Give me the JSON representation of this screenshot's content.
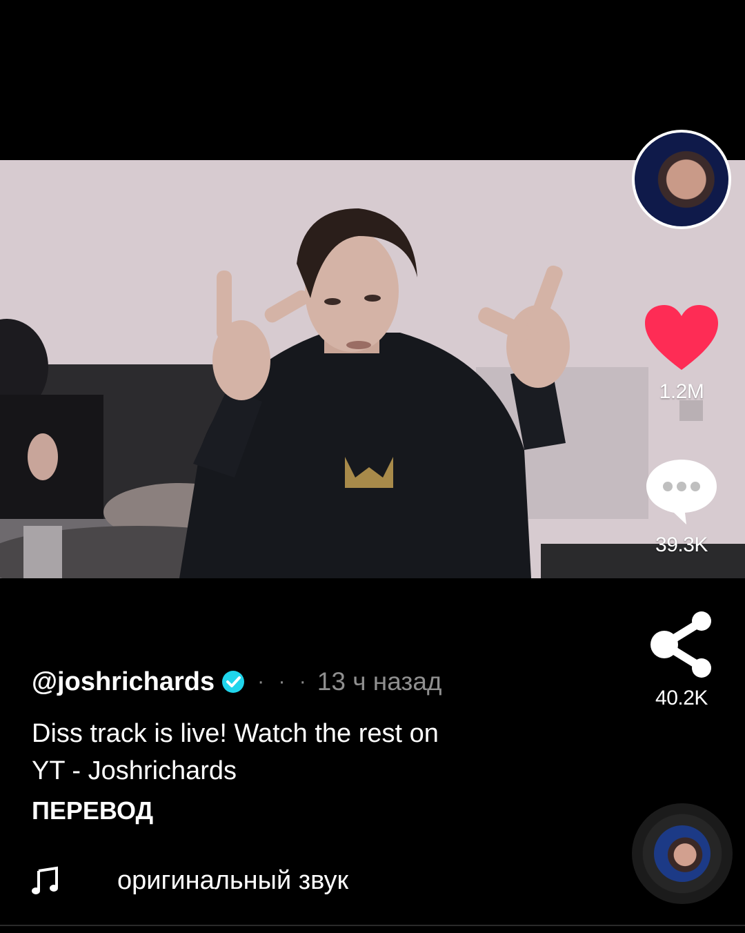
{
  "post": {
    "username": "@joshrichards",
    "verified": true,
    "separator": "· · ·",
    "time_ago": "13 ч назад",
    "caption_line1": "Diss track is live! Watch the rest on",
    "caption_line2": "YT - Joshrichards",
    "translate_label": "ПЕРЕВОД",
    "sound_name": "оригинальный звук"
  },
  "actions": {
    "likes": "1.2M",
    "comments": "39.3K",
    "shares": "40.2K"
  },
  "colors": {
    "background": "#000000",
    "like": "#fe2c55",
    "verified_badge": "#20d5ec",
    "muted_text": "#8f8f8f"
  },
  "icons": {
    "avatar": "profile-avatar",
    "like": "heart-icon",
    "comment": "comment-bubble-icon",
    "share": "share-icon",
    "verified": "verified-check-icon",
    "music": "music-note-icon",
    "disc": "spinning-disc"
  }
}
